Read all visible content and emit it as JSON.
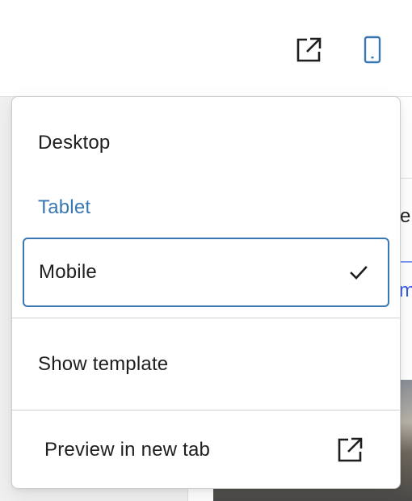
{
  "toolbar": {
    "preview_icon": "external-link-icon",
    "device_icon": "mobile-device-icon",
    "accent_color": "#3a78b4"
  },
  "menu": {
    "items": [
      {
        "label": "Desktop",
        "selected": false
      },
      {
        "label": "Tablet",
        "selected": false
      },
      {
        "label": "Mobile",
        "selected": true
      },
      {
        "label": "Show template"
      },
      {
        "label": "Preview in new tab",
        "icon": "external-link-icon"
      }
    ],
    "check_icon": "checkmark-icon"
  },
  "canvas": {
    "fragment_1": "e",
    "fragment_2": "m"
  }
}
